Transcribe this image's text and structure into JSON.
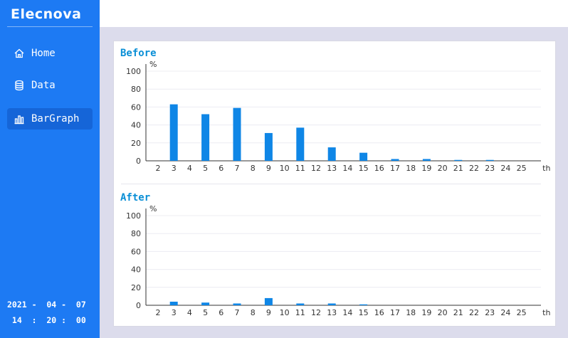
{
  "app": {
    "brand": "Elecnova"
  },
  "sidebar": {
    "items": [
      {
        "label": "Home",
        "icon": "home-icon"
      },
      {
        "label": "Data",
        "icon": "database-icon"
      },
      {
        "label": "BarGraph",
        "icon": "bar-chart-icon",
        "active": true
      }
    ]
  },
  "clock": {
    "date": "2021 -  04 -  07",
    "time": " 14  :  20 :  00"
  },
  "colors": {
    "sidebar": "#1d7af3",
    "bar": "#0f86e6",
    "title": "#0a8fd6",
    "background": "#dcdcec"
  },
  "chart_data": [
    {
      "type": "bar",
      "title": "Before",
      "ylabel": "%",
      "xlabel": "th",
      "ylim": [
        0,
        100
      ],
      "yticks": [
        0,
        20,
        40,
        60,
        80,
        100
      ],
      "grid": true,
      "categories": [
        "2",
        "3",
        "4",
        "5",
        "6",
        "7",
        "8",
        "9",
        "10",
        "11",
        "12",
        "13",
        "14",
        "15",
        "16",
        "17",
        "18",
        "19",
        "20",
        "21",
        "22",
        "23",
        "24",
        "25"
      ],
      "values": [
        0,
        63,
        0,
        52,
        0,
        59,
        0,
        31,
        0,
        37,
        0,
        15,
        0,
        9,
        0,
        2,
        0,
        2,
        0,
        1,
        0,
        1,
        0,
        0
      ]
    },
    {
      "type": "bar",
      "title": "After",
      "ylabel": "%",
      "xlabel": "th",
      "ylim": [
        0,
        100
      ],
      "yticks": [
        0,
        20,
        40,
        60,
        80,
        100
      ],
      "grid": true,
      "categories": [
        "2",
        "3",
        "4",
        "5",
        "6",
        "7",
        "8",
        "9",
        "10",
        "11",
        "12",
        "13",
        "14",
        "15",
        "16",
        "17",
        "18",
        "19",
        "20",
        "21",
        "22",
        "23",
        "24",
        "25"
      ],
      "values": [
        0,
        4,
        0,
        3,
        0,
        2,
        0,
        8,
        0,
        2,
        0,
        2,
        0,
        1,
        0,
        0,
        0,
        0,
        0,
        0,
        0,
        0,
        0,
        0
      ]
    }
  ]
}
